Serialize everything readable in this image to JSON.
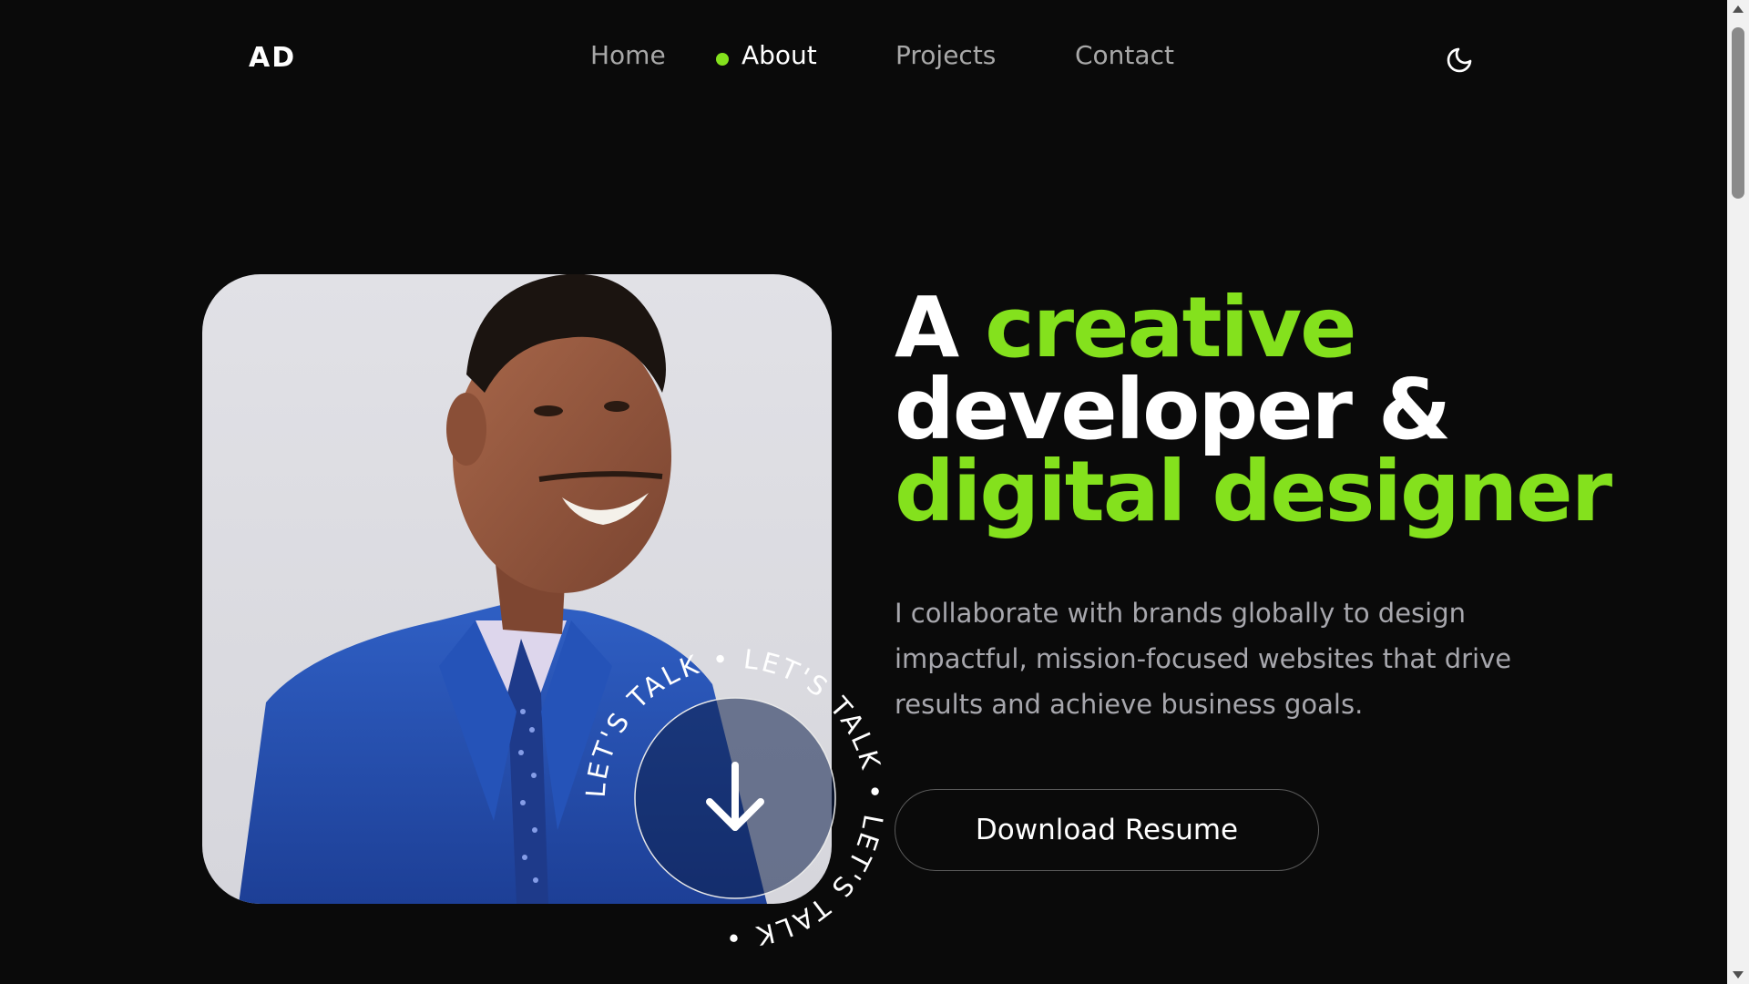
{
  "brand": {
    "logo_text": "AD"
  },
  "nav": {
    "items": [
      {
        "label": "Home",
        "active": false
      },
      {
        "label": "About",
        "active": true
      },
      {
        "label": "Projects",
        "active": false
      },
      {
        "label": "Contact",
        "active": false
      }
    ],
    "theme_toggle_icon": "moon-icon"
  },
  "hero": {
    "title_word_1": "A",
    "title_word_2": "creative",
    "title_line_2": "developer &",
    "title_line_3": "digital designer",
    "subtitle": "I collaborate with brands globally to design impactful, mission-focused websites that drive results and achieve business goals.",
    "cta_label": "Download Resume"
  },
  "badge": {
    "ring_text": "LET'S TALK • LET'S TALK • LET'S TALK • ",
    "icon": "arrow-down-icon"
  },
  "colors": {
    "accent": "#84e11d",
    "background": "#0a0a0a",
    "text": "#ffffff",
    "muted": "#a7a7ad"
  }
}
